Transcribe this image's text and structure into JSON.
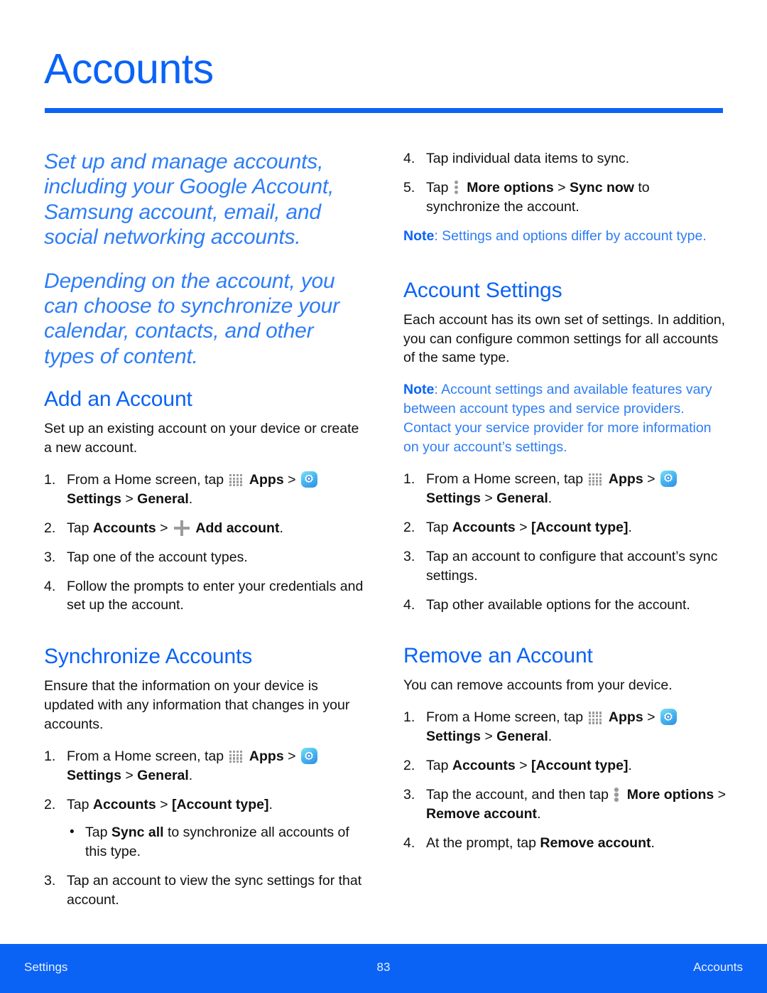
{
  "document": {
    "title": "Accounts",
    "accent_color": "#0a63f5",
    "note_color": "#2d7df6"
  },
  "left_column": {
    "intro_paragraph_1": "Set up and manage accounts, including your Google Account, Samsung account, email, and social networking accounts.",
    "intro_paragraph_2": "Depending on the account, you can choose to synchronize your calendar, contacts, and other types of content.",
    "add_account": {
      "heading": "Add an Account",
      "body": "Set up an existing account on your device or create a new account.",
      "steps": [
        {
          "num": "1.",
          "parts": [
            {
              "t": "text",
              "v": "From a Home screen, tap "
            },
            {
              "t": "icon",
              "v": "apps-grid-icon"
            },
            {
              "t": "bold",
              "v": "Apps"
            },
            {
              "t": "text",
              "v": " > "
            },
            {
              "t": "icon",
              "v": "settings-gear-icon"
            },
            {
              "t": "bold",
              "v": "Settings"
            },
            {
              "t": "text",
              "v": " > "
            },
            {
              "t": "bold",
              "v": "General"
            },
            {
              "t": "text",
              "v": "."
            }
          ]
        },
        {
          "num": "2.",
          "parts": [
            {
              "t": "text",
              "v": "Tap "
            },
            {
              "t": "bold",
              "v": "Accounts"
            },
            {
              "t": "text",
              "v": " > "
            },
            {
              "t": "icon",
              "v": "plus-icon"
            },
            {
              "t": "bold",
              "v": "Add account"
            },
            {
              "t": "text",
              "v": "."
            }
          ]
        },
        {
          "num": "3.",
          "parts": [
            {
              "t": "text",
              "v": "Tap one of the account types."
            }
          ]
        },
        {
          "num": "4.",
          "parts": [
            {
              "t": "text",
              "v": "Follow the prompts to enter your credentials and set up the account."
            }
          ]
        }
      ]
    },
    "synchronize_accounts": {
      "heading": "Synchronize Accounts",
      "body": "Ensure that the information on your device is updated with any information that changes in your accounts.",
      "steps": [
        {
          "num": "1.",
          "parts": [
            {
              "t": "text",
              "v": "From a Home screen, tap "
            },
            {
              "t": "icon",
              "v": "apps-grid-icon"
            },
            {
              "t": "bold",
              "v": "Apps"
            },
            {
              "t": "text",
              "v": " > "
            },
            {
              "t": "icon",
              "v": "settings-gear-icon"
            },
            {
              "t": "bold",
              "v": "Settings"
            },
            {
              "t": "text",
              "v": " > "
            },
            {
              "t": "bold",
              "v": "General"
            },
            {
              "t": "text",
              "v": "."
            }
          ]
        },
        {
          "num": "2.",
          "parts": [
            {
              "t": "text",
              "v": "Tap "
            },
            {
              "t": "bold",
              "v": "Accounts"
            },
            {
              "t": "text",
              "v": " > "
            },
            {
              "t": "bold",
              "v": "[Account type]"
            },
            {
              "t": "text",
              "v": "."
            }
          ],
          "subbullets": [
            {
              "parts": [
                {
                  "t": "text",
                  "v": "Tap "
                },
                {
                  "t": "bold",
                  "v": "Sync all"
                },
                {
                  "t": "text",
                  "v": " to synchronize all accounts of this type."
                }
              ]
            }
          ]
        },
        {
          "num": "3.",
          "parts": [
            {
              "t": "text",
              "v": "Tap an account to view the sync settings for that account."
            }
          ]
        }
      ]
    }
  },
  "right_column": {
    "continued_steps": [
      {
        "num": "4.",
        "parts": [
          {
            "t": "text",
            "v": "Tap individual data items to sync."
          }
        ]
      },
      {
        "num": "5.",
        "parts": [
          {
            "t": "text",
            "v": "Tap "
          },
          {
            "t": "icon",
            "v": "more-options-icon"
          },
          {
            "t": "bold",
            "v": "More options"
          },
          {
            "t": "text",
            "v": " > "
          },
          {
            "t": "bold",
            "v": "Sync now"
          },
          {
            "t": "text",
            "v": " to synchronize the account."
          }
        ]
      }
    ],
    "note_1": {
      "label": "Note",
      "text": ": Settings and options differ by account type."
    },
    "account_settings": {
      "heading": "Account Settings",
      "body": "Each account has its own set of settings. In addition, you can configure common settings for all accounts of the same type.",
      "note": {
        "label": "Note",
        "text": ": Account settings and available features vary between account types and service providers. Contact your service provider for more information on your account’s settings."
      },
      "steps": [
        {
          "num": "1.",
          "parts": [
            {
              "t": "text",
              "v": "From a Home screen, tap "
            },
            {
              "t": "icon",
              "v": "apps-grid-icon"
            },
            {
              "t": "bold",
              "v": "Apps"
            },
            {
              "t": "text",
              "v": " > "
            },
            {
              "t": "icon",
              "v": "settings-gear-icon"
            },
            {
              "t": "bold",
              "v": "Settings"
            },
            {
              "t": "text",
              "v": " > "
            },
            {
              "t": "bold",
              "v": "General"
            },
            {
              "t": "text",
              "v": "."
            }
          ]
        },
        {
          "num": "2.",
          "parts": [
            {
              "t": "text",
              "v": "Tap "
            },
            {
              "t": "bold",
              "v": "Accounts"
            },
            {
              "t": "text",
              "v": " > "
            },
            {
              "t": "bold",
              "v": "[Account type]"
            },
            {
              "t": "text",
              "v": "."
            }
          ]
        },
        {
          "num": "3.",
          "parts": [
            {
              "t": "text",
              "v": "Tap an account to configure that account’s sync settings."
            }
          ]
        },
        {
          "num": "4.",
          "parts": [
            {
              "t": "text",
              "v": "Tap other available options for the account."
            }
          ]
        }
      ]
    },
    "remove_account": {
      "heading": "Remove an Account",
      "body": "You can remove accounts from your device.",
      "steps": [
        {
          "num": "1.",
          "parts": [
            {
              "t": "text",
              "v": "From a Home screen, tap "
            },
            {
              "t": "icon",
              "v": "apps-grid-icon"
            },
            {
              "t": "bold",
              "v": "Apps"
            },
            {
              "t": "text",
              "v": " > "
            },
            {
              "t": "icon",
              "v": "settings-gear-icon"
            },
            {
              "t": "bold",
              "v": "Settings"
            },
            {
              "t": "text",
              "v": " > "
            },
            {
              "t": "bold",
              "v": "General"
            },
            {
              "t": "text",
              "v": "."
            }
          ]
        },
        {
          "num": "2.",
          "parts": [
            {
              "t": "text",
              "v": "Tap "
            },
            {
              "t": "bold",
              "v": "Accounts"
            },
            {
              "t": "text",
              "v": " > "
            },
            {
              "t": "bold",
              "v": "[Account type]"
            },
            {
              "t": "text",
              "v": "."
            }
          ]
        },
        {
          "num": "3.",
          "parts": [
            {
              "t": "text",
              "v": "Tap the account, and then tap "
            },
            {
              "t": "icon",
              "v": "more-options-icon"
            },
            {
              "t": "bold",
              "v": "More options"
            },
            {
              "t": "text",
              "v": " > "
            },
            {
              "t": "bold",
              "v": "Remove account"
            },
            {
              "t": "text",
              "v": "."
            }
          ]
        },
        {
          "num": "4.",
          "parts": [
            {
              "t": "text",
              "v": "At the prompt, tap "
            },
            {
              "t": "bold",
              "v": "Remove account"
            },
            {
              "t": "text",
              "v": "."
            }
          ]
        }
      ]
    }
  },
  "footer": {
    "left": "Settings",
    "page_number": "83",
    "right": "Accounts"
  }
}
